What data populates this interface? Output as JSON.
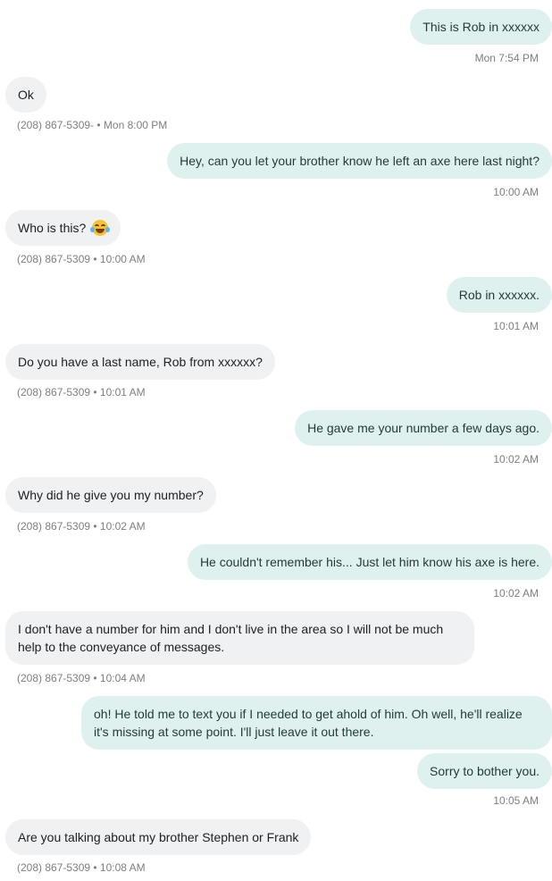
{
  "messages": [
    {
      "dir": "out",
      "text": "This is Rob in xxxxxx",
      "meta": "Mon 7:54 PM"
    },
    {
      "dir": "in",
      "text": "Ok",
      "meta": "(208) 867-5309- • Mon 8:00 PM"
    },
    {
      "dir": "out",
      "text": "Hey, can you let your brother know he left an axe here last night?",
      "meta": "10:00 AM"
    },
    {
      "dir": "in",
      "text": "Who is this?",
      "emoji": "laughing-tears-emoji",
      "meta": "(208) 867-5309 • 10:00 AM"
    },
    {
      "dir": "out",
      "text": "Rob in xxxxxx.",
      "meta": "10:01 AM"
    },
    {
      "dir": "in",
      "text": "Do you have a last name, Rob from xxxxxx?",
      "meta": "(208) 867-5309 • 10:01 AM"
    },
    {
      "dir": "out",
      "text": "He gave me your number a few days ago.",
      "meta": "10:02 AM"
    },
    {
      "dir": "in",
      "text": "Why did he give you my number?",
      "meta": "(208) 867-5309 • 10:02 AM"
    },
    {
      "dir": "out",
      "text": "He couldn't remember his...  Just let him know his axe is here.",
      "meta": "10:02 AM"
    },
    {
      "dir": "in",
      "text": "I don't have a number for him and I don't live in the area so I will not be much help to the conveyance of messages.",
      "meta": "(208) 867-5309 • 10:04 AM"
    },
    {
      "dir": "out",
      "text": "oh!  He told me to text you if I needed to get ahold of him.  Oh well, he'll realize it's missing at some point.  I'll just leave it out there."
    },
    {
      "dir": "out",
      "text": "Sorry to bother you.",
      "meta": "10:05 AM"
    },
    {
      "dir": "in",
      "text": "Are you talking about my brother Stephen or Frank",
      "meta": "(208) 867-5309 • 10:08 AM"
    }
  ]
}
